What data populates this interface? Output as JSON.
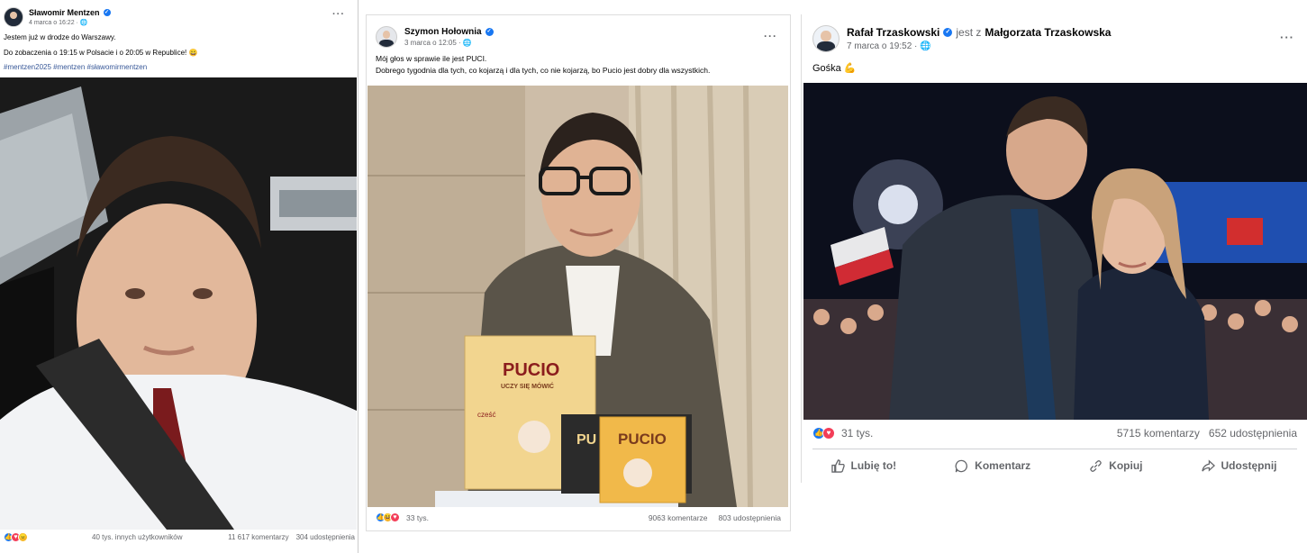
{
  "posts": [
    {
      "author": "Sławomir Mentzen",
      "date": "4 marca o 16:22 · ",
      "globe_icon": "globe-icon",
      "lines": [
        "Jestem już w drodze do Warszawy.",
        "Do zobaczenia o 19:15 w Polsacie i o 20:05 w Republice! 😀"
      ],
      "hashtags": "#mentzen2025 #mentzen #sławomirmentzen",
      "reactions_label": "40 tys. innych użytkowników",
      "comments": "11 617 komentarzy",
      "shares": "304 udostępnienia",
      "more": "···"
    },
    {
      "author": "Szymon Hołownia",
      "date": "3 marca o 12:05 · ",
      "lines": [
        "Mój głos w sprawie ile jest PUCI.",
        "Dobrego tygodnia dla tych, co kojarzą i dla tych, co nie kojarzą, bo Pucio jest dobry dla wszystkich."
      ],
      "reactions_label": "33 tys.",
      "comments": "9063 komentarze",
      "shares": "803 udostępnienia",
      "more": "···",
      "book_title": "PUCIO",
      "book_subtitle": "UCZY SIĘ MÓWIĆ",
      "book_word": "cześć",
      "small_book": "PUCIO",
      "small_book2": "PU"
    },
    {
      "author": "Rafał Trzaskowski",
      "with_prefix": "jest z",
      "with_name": "Małgorzata Trzaskowska",
      "date": "7 marca o 19:52 · ",
      "lines": [
        "Gośka 💪"
      ],
      "reactions_label": "31 tys.",
      "comments": "5715 komentarzy",
      "shares": "652 udostępnienia",
      "more": "···",
      "actions": {
        "like": "Lubię to!",
        "comment": "Komentarz",
        "copy": "Kopiuj",
        "share": "Udostępnij"
      }
    }
  ],
  "colors": {
    "accent": "#1877f2",
    "muted": "#65676b",
    "hashtag": "#385898"
  }
}
